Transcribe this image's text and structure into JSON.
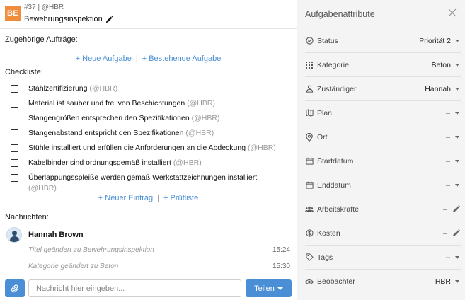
{
  "header": {
    "badge": "BE",
    "task_id": "#37 | @HBR",
    "title": "Bewehrungsinspektion"
  },
  "related": {
    "label": "Zugehörige Aufträge:",
    "new_task": "+ Neue Aufgabe",
    "separator": "|",
    "existing_task": "+ Bestehende Aufgabe"
  },
  "checklist": {
    "label": "Checkliste:",
    "items": [
      {
        "text": "Stahlzertifizierung",
        "author": "(@HBR)"
      },
      {
        "text": "Material ist sauber und frei von Beschichtungen",
        "author": "(@HBR)"
      },
      {
        "text": "Stangengrößen entsprechen den Spezifikationen",
        "author": "(@HBR)"
      },
      {
        "text": "Stangenabstand entspricht den Spezifikationen",
        "author": "(@HBR)"
      },
      {
        "text": "Stühle installiert und erfüllen die Anforderungen an die Abdeckung",
        "author": "(@HBR)"
      },
      {
        "text": "Kabelbinder sind ordnungsgemäß installiert",
        "author": "(@HBR)"
      },
      {
        "text": "Überlappungsspleiße werden gemäß Werkstattzeichnungen installiert",
        "author": "(@HBR)"
      }
    ],
    "new_entry": "+ Neuer Eintrag",
    "separator": "|",
    "checklist_link": "+ Prüfliste"
  },
  "messages": {
    "label": "Nachrichten:",
    "user": "Hannah Brown",
    "entries": [
      {
        "text": "Titel geändert zu Bewehrungsinspektion",
        "time": "15:24"
      },
      {
        "text": "Kategorie geändert zu Beton",
        "time": "15:30"
      }
    ],
    "input_placeholder": "Nachricht hier eingeben...",
    "share_label": "Teilen"
  },
  "attributes": {
    "title": "Aufgabenattribute",
    "items": [
      {
        "label": "Status",
        "value": "Priorität 2",
        "icon": "status-icon",
        "control": "dropdown"
      },
      {
        "label": "Kategorie",
        "value": "Beton",
        "icon": "grid-icon",
        "control": "dropdown"
      },
      {
        "label": "Zuständiger",
        "value": "Hannah",
        "icon": "person-icon",
        "control": "dropdown"
      },
      {
        "label": "Plan",
        "value": "–",
        "icon": "map-icon",
        "control": "dropdown"
      },
      {
        "label": "Ort",
        "value": "–",
        "icon": "pin-icon",
        "control": "dropdown"
      },
      {
        "label": "Startdatum",
        "value": "–",
        "icon": "calendar-icon",
        "control": "dropdown"
      },
      {
        "label": "Enddatum",
        "value": "–",
        "icon": "calendar-icon",
        "control": "dropdown"
      },
      {
        "label": "Arbeitskräfte",
        "value": "–",
        "icon": "people-icon",
        "control": "edit"
      },
      {
        "label": "Kosten",
        "value": "–",
        "icon": "dollar-icon",
        "control": "edit"
      },
      {
        "label": "Tags",
        "value": "–",
        "icon": "tag-icon",
        "control": "dropdown"
      },
      {
        "label": "Beobachter",
        "value": "HBR",
        "icon": "eye-icon",
        "control": "dropdown"
      }
    ]
  },
  "colors": {
    "accent": "#4a8fd6",
    "badge": "#ef8d3c",
    "panel_bg": "#f4f4f4"
  }
}
